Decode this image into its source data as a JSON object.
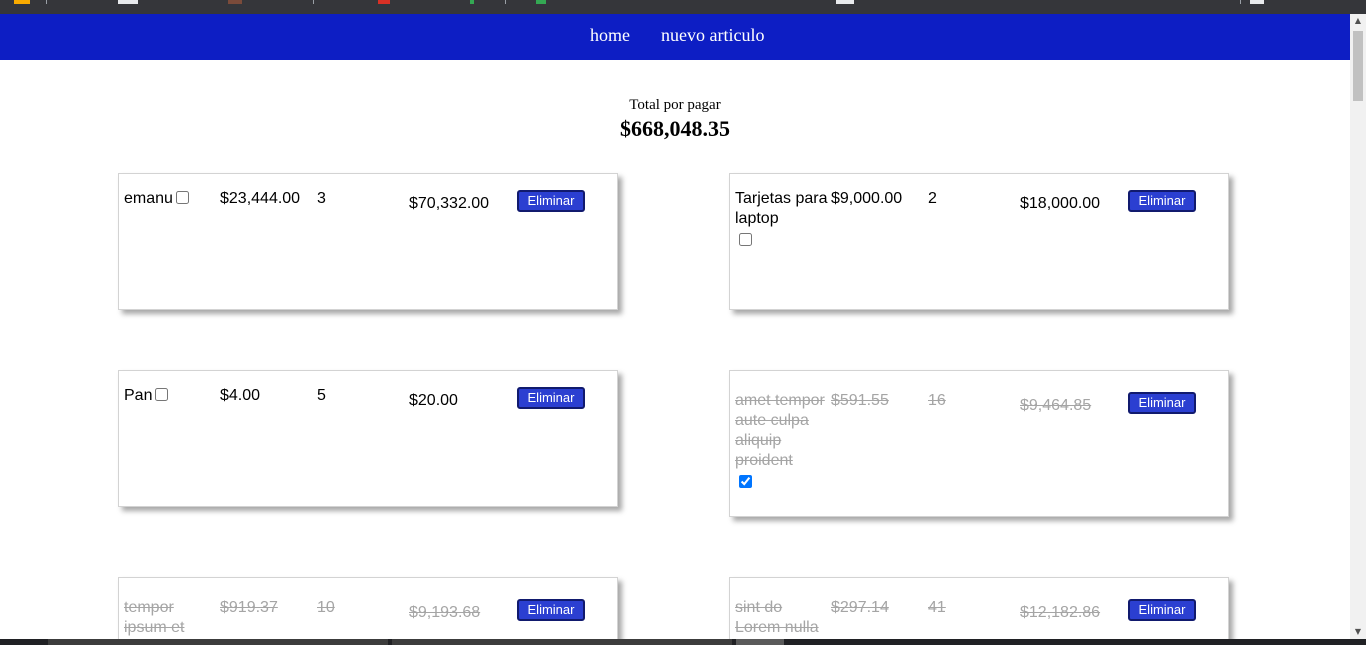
{
  "nav": {
    "home": "home",
    "new_item": "nuevo articulo"
  },
  "summary": {
    "label": "Total por pagar",
    "total": "$668,048.35"
  },
  "items": [
    {
      "name": "emanu",
      "price": "$23,444.00",
      "qty": "3",
      "subtotal": "$70,332.00",
      "checked": false,
      "button": "Eliminar"
    },
    {
      "name": "Tarjetas para laptop",
      "price": "$9,000.00",
      "qty": "2",
      "subtotal": "$18,000.00",
      "checked": false,
      "button": "Eliminar"
    },
    {
      "name": "Pan",
      "price": "$4.00",
      "qty": "5",
      "subtotal": "$20.00",
      "checked": false,
      "button": "Eliminar"
    },
    {
      "name": "amet tempor aute culpa aliquip proident",
      "price": "$591.55",
      "qty": "16",
      "subtotal": "$9,464.85",
      "checked": true,
      "button": "Eliminar"
    },
    {
      "name": "tempor ipsum et",
      "price": "$919.37",
      "qty": "10",
      "subtotal": "$9,193.68",
      "checked": true,
      "button": "Eliminar"
    },
    {
      "name": "sint do Lorem nulla",
      "price": "$297.14",
      "qty": "41",
      "subtotal": "$12,182.86",
      "checked": true,
      "button": "Eliminar"
    }
  ],
  "colors": {
    "navbar": "#0d1ec4",
    "button": "#2b3fd1",
    "done_text": "#a5a5a5"
  },
  "icons": {
    "scroll_up": "▲",
    "scroll_down": "▼"
  }
}
